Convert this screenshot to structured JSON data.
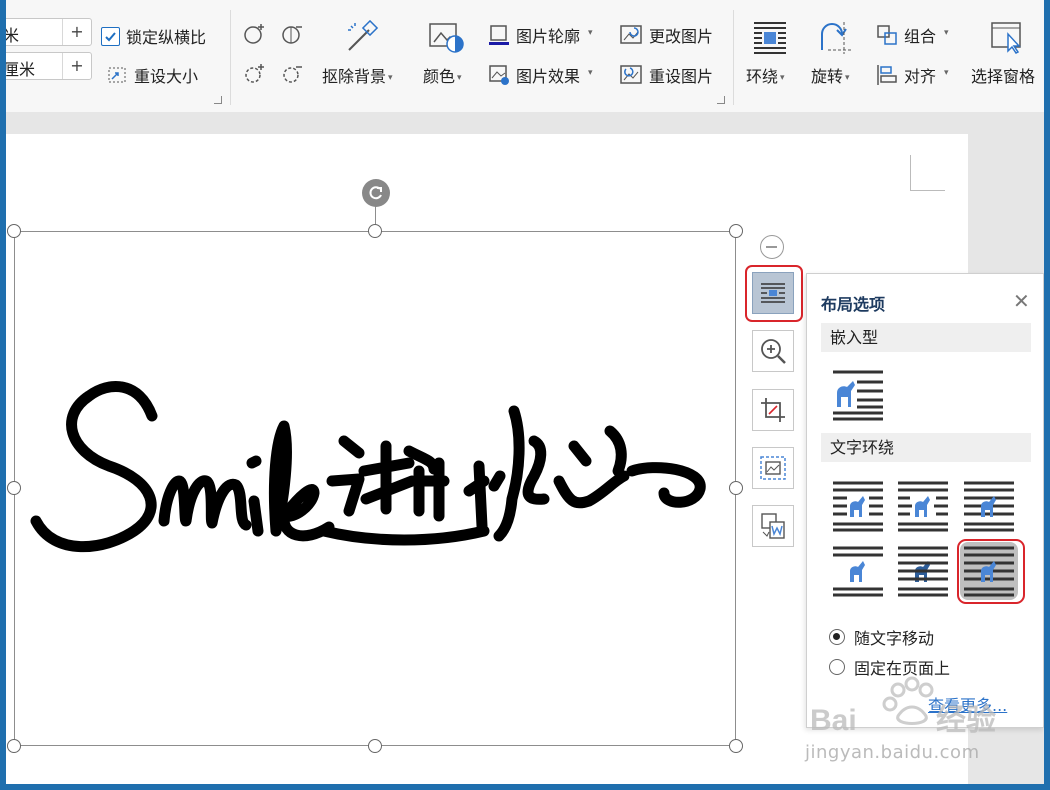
{
  "ribbon": {
    "width_value": "米",
    "height_value": "厘米",
    "plus_label": "+",
    "lock_ratio_label": "锁定纵横比",
    "lock_ratio_checked": true,
    "reset_size_label": "重设大小",
    "remove_bg_label": "抠除背景",
    "color_label": "颜色",
    "outline_label": "图片轮廓",
    "effect_label": "图片效果",
    "change_label": "更改图片",
    "reset_pic_label": "重设图片",
    "wrap_label": "环绕",
    "rotate_label": "旋转",
    "group_label": "组合",
    "align_label": "对齐",
    "select_pane_label": "选择窗格"
  },
  "layout_panel": {
    "title": "布局选项",
    "inline_section": "嵌入型",
    "wrap_section": "文字环绕",
    "move_with_text": "随文字移动",
    "fix_on_page": "固定在页面上",
    "see_more": "查看更多..."
  },
  "watermark": {
    "url": "jingyan.baidu.com",
    "brand": "Baidu 经验"
  },
  "colors": {
    "accent_blue": "#1f6fae",
    "icon_blue": "#4a86d6",
    "highlight_red": "#d9252b"
  }
}
